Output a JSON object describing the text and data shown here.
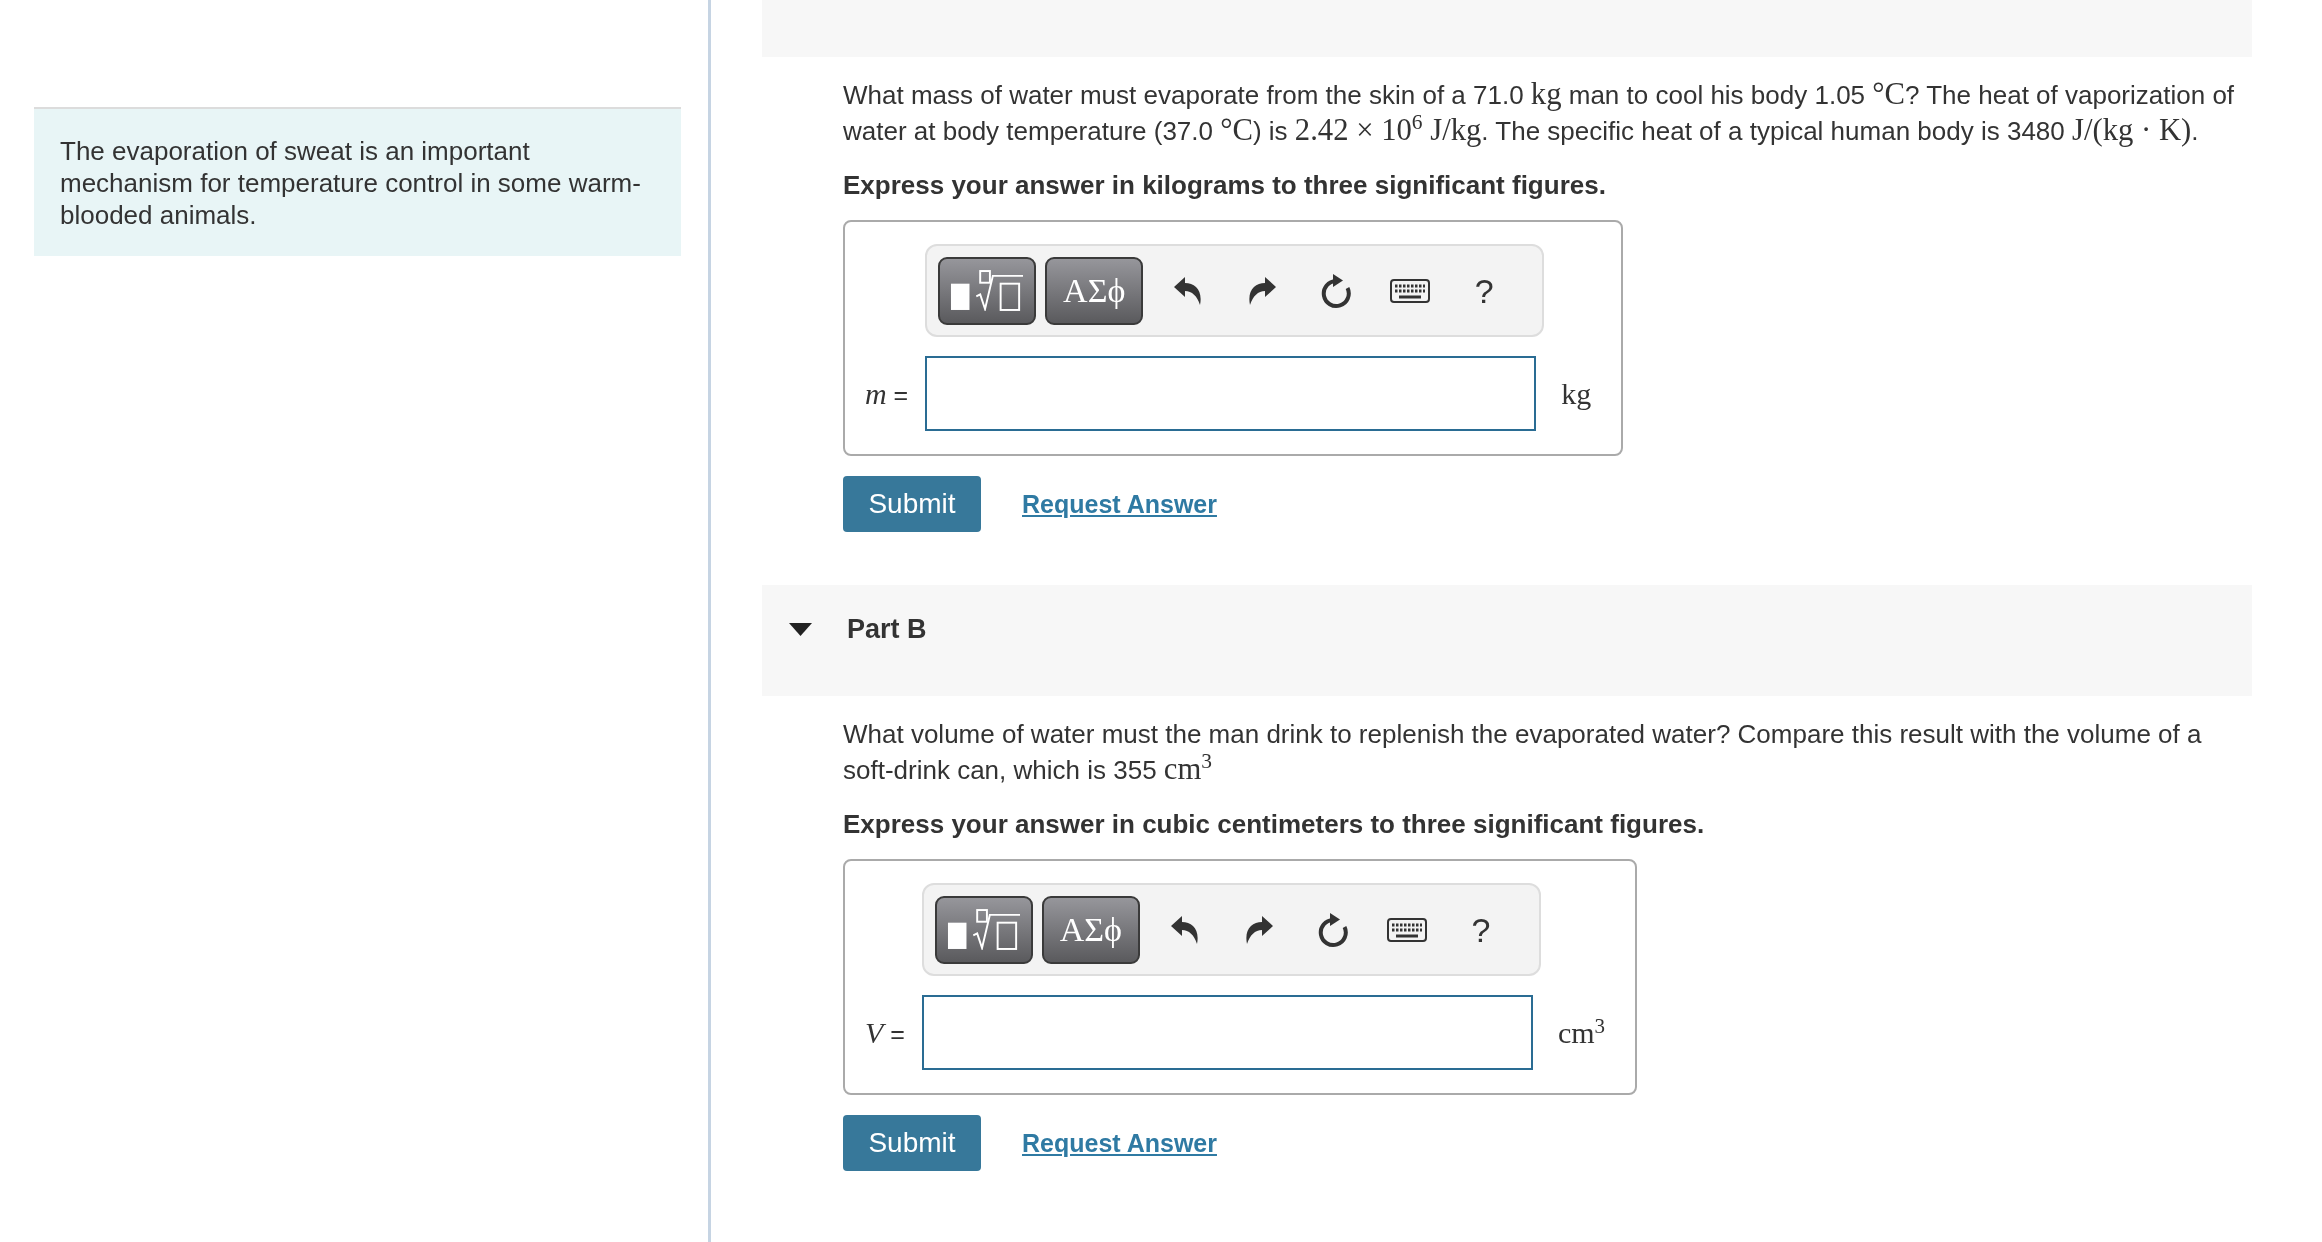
{
  "sidebar": {
    "intro": "The evaporation of sweat is an important mechanism for temperature control in some warm-blooded animals."
  },
  "parts": [
    {
      "question": [
        {
          "kind": "text",
          "text": "What mass of water must evaporate from the skin of a 71.0 "
        },
        {
          "kind": "math",
          "text": "kg"
        },
        {
          "kind": "text",
          "text": " man to cool his body 1.05 "
        },
        {
          "kind": "math",
          "text": "°C"
        },
        {
          "kind": "text",
          "text": "? The heat of vaporization of water at body temperature (37.0 "
        },
        {
          "kind": "math",
          "text": "°C"
        },
        {
          "kind": "text",
          "text": ") is "
        },
        {
          "kind": "math",
          "text": "2.42 × 10$^{6}$ J/kg"
        },
        {
          "kind": "text",
          "text": ". The specific heat of a typical human body is 3480 "
        },
        {
          "kind": "math",
          "text": "J/(kg · K)"
        },
        {
          "kind": "text",
          "text": "."
        }
      ],
      "instruction": "Express your answer in kilograms to three significant figures.",
      "toolbar": [
        {
          "kind": "templates"
        },
        {
          "kind": "symbols",
          "label": "ΑΣϕ"
        },
        {
          "kind": "undo"
        },
        {
          "kind": "redo"
        },
        {
          "kind": "reset"
        },
        {
          "kind": "keyboard"
        },
        {
          "kind": "help",
          "label": "?"
        }
      ],
      "answer": {
        "label": "*m* =",
        "unit": "kg"
      },
      "actions": [
        {
          "kind": "submit",
          "label": "Submit"
        },
        {
          "kind": "link",
          "label": "Request Answer"
        }
      ]
    },
    {
      "title": "Part B",
      "expanded": true,
      "question": [
        {
          "kind": "text",
          "text": "What volume of water must the man drink to replenish the evaporated water? Compare this result with the volume of a soft-drink can, which is 355 "
        },
        {
          "kind": "math",
          "text": "cm$^{3}$"
        }
      ],
      "instruction": "Express your answer in cubic centimeters to three significant figures.",
      "toolbar": [
        {
          "kind": "templates"
        },
        {
          "kind": "symbols",
          "label": "ΑΣϕ"
        },
        {
          "kind": "undo"
        },
        {
          "kind": "redo"
        },
        {
          "kind": "reset"
        },
        {
          "kind": "keyboard"
        },
        {
          "kind": "help",
          "label": "?"
        }
      ],
      "answer": {
        "label": "*V* =",
        "unit": "cm$^{3}$"
      },
      "actions": [
        {
          "kind": "submit",
          "label": "Submit"
        },
        {
          "kind": "link",
          "label": "Request Answer"
        }
      ]
    }
  ]
}
